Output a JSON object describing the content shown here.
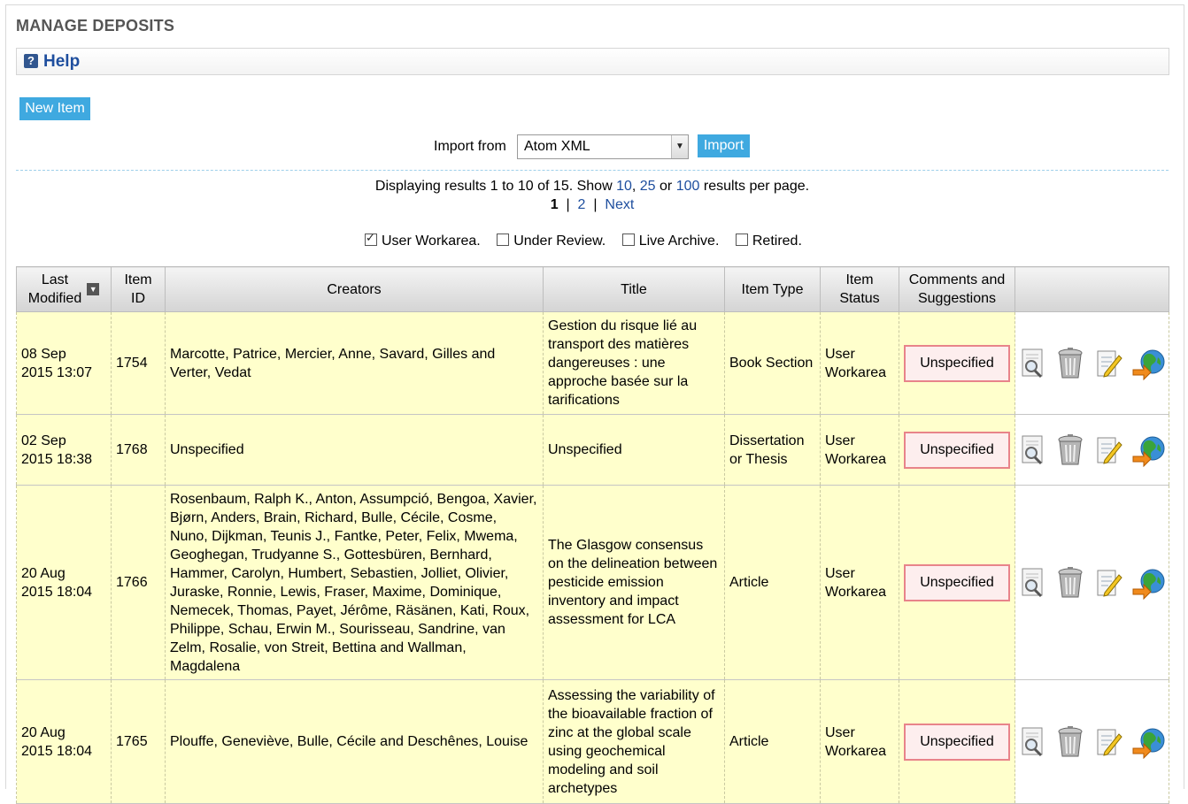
{
  "page": {
    "title": "MANAGE DEPOSITS",
    "help_label": "Help"
  },
  "toolbar": {
    "new_item_label": "New Item",
    "import_label": "Import from",
    "import_select_value": "Atom XML",
    "import_button_label": "Import"
  },
  "paging": {
    "summary_prefix": "Displaying results 1 to 10 of 15. Show",
    "opt10": "10",
    "comma": ",",
    "opt25": "25",
    "or": "or",
    "opt100": "100",
    "summary_suffix": "results per page.",
    "current": "1",
    "sep": "|",
    "page2": "2",
    "next": "Next"
  },
  "filters": [
    {
      "label": "User Workarea.",
      "checked": true
    },
    {
      "label": "Under Review.",
      "checked": false
    },
    {
      "label": "Live Archive.",
      "checked": false
    },
    {
      "label": "Retired.",
      "checked": false
    }
  ],
  "table": {
    "headers": {
      "last_modified_1": "Last",
      "last_modified_2": "Modified",
      "item_id_1": "Item",
      "item_id_2": "ID",
      "creators": "Creators",
      "title": "Title",
      "item_type": "Item Type",
      "item_status_1": "Item",
      "item_status_2": "Status",
      "comments_1": "Comments and",
      "comments_2": "Suggestions"
    },
    "rows": [
      {
        "date1": "08 Sep",
        "date2": "2015 13:07",
        "id": "1754",
        "creators": "Marcotte, Patrice, Mercier, Anne, Savard, Gilles and Verter, Vedat",
        "title": "Gestion du risque lié au transport des matières dangereuses : une approche basée sur la tarifications",
        "type": "Book Section",
        "status": "User Workarea",
        "comments": "Unspecified"
      },
      {
        "date1": "02 Sep",
        "date2": "2015 18:38",
        "id": "1768",
        "creators": "Unspecified",
        "title": "Unspecified",
        "type": "Dissertation or Thesis",
        "status": "User Workarea",
        "comments": "Unspecified"
      },
      {
        "date1": "20 Aug",
        "date2": "2015 18:04",
        "id": "1766",
        "creators": "Rosenbaum, Ralph K., Anton, Assumpció, Bengoa, Xavier, Bjørn, Anders, Brain, Richard, Bulle, Cécile, Cosme, Nuno, Dijkman, Teunis J., Fantke, Peter, Felix, Mwema, Geoghegan, Trudyanne S., Gottesbüren, Bernhard, Hammer, Carolyn, Humbert, Sebastien, Jolliet, Olivier, Juraske, Ronnie, Lewis, Fraser, Maxime, Dominique, Nemecek, Thomas, Payet, Jérôme, Räsänen, Kati, Roux, Philippe, Schau, Erwin M., Sourisseau, Sandrine, van Zelm, Rosalie, von Streit, Bettina and Wallman, Magdalena",
        "title": "The Glasgow consensus on the delineation between pesticide emission inventory and impact assessment for LCA",
        "type": "Article",
        "status": "User Workarea",
        "comments": "Unspecified"
      },
      {
        "date1": "20 Aug",
        "date2": "2015 18:04",
        "id": "1765",
        "creators": "Plouffe, Geneviève, Bulle, Cécile and Deschênes, Louise",
        "title": "Assessing the variability of the bioavailable fraction of zinc at the global scale using geochemical modeling and soil archetypes",
        "type": "Article",
        "status": "User Workarea",
        "comments": "Unspecified"
      }
    ]
  },
  "colors": {
    "accent": "#3fa9e0",
    "link": "#1e4e9e",
    "row_bg": "#ffffcc",
    "comment_border": "#e8848a"
  },
  "icons": [
    "help-icon",
    "sort-desc-icon",
    "view-icon",
    "delete-icon",
    "edit-icon",
    "deposit-icon"
  ]
}
